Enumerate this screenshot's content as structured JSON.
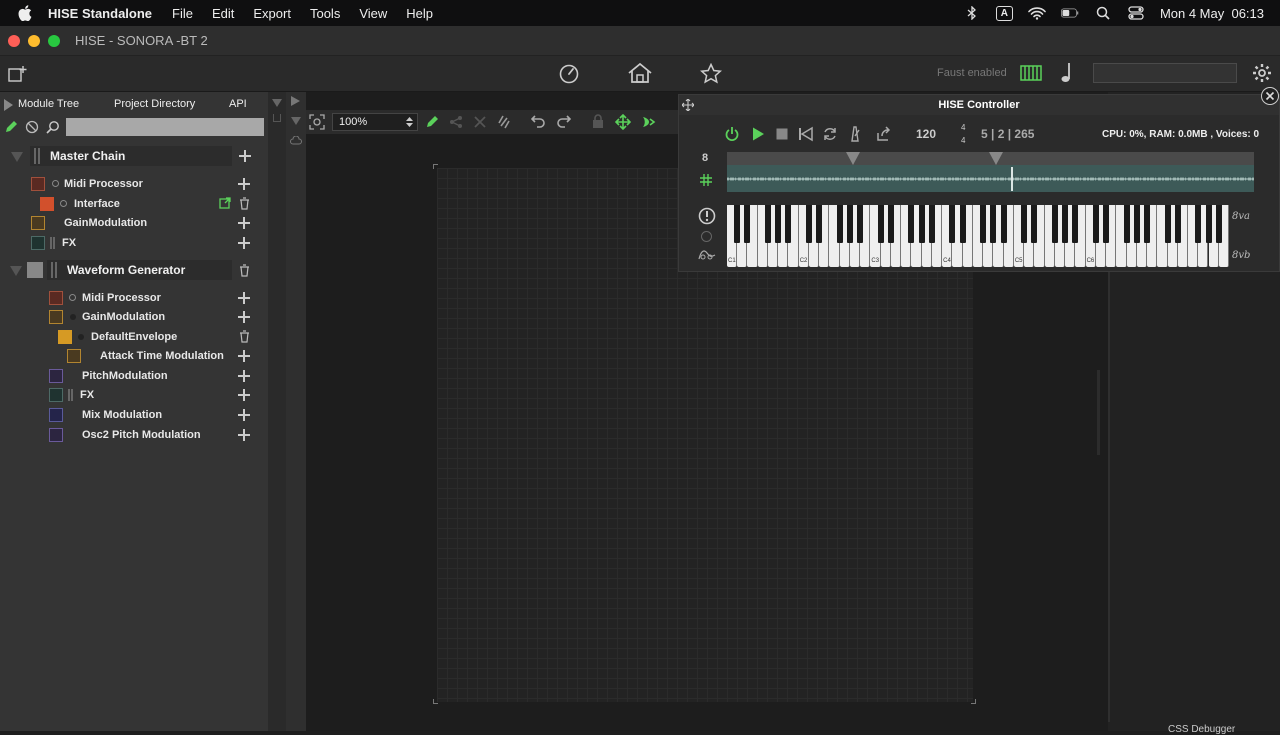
{
  "menubar": {
    "app_name": "HISE Standalone",
    "menus": [
      "File",
      "Edit",
      "Export",
      "Tools",
      "View",
      "Help"
    ],
    "input_source": "A",
    "clock": "Mon 4 May  06:13"
  },
  "window": {
    "title": "HISE - SONORA -BT 2"
  },
  "toolbar": {
    "faust_status": "Faust enabled"
  },
  "left_panel": {
    "tabs": [
      "Module Tree",
      "Project Directory",
      "API"
    ],
    "search_placeholder": "",
    "tree": {
      "master_chain": "Master Chain",
      "master_children": [
        {
          "label": "Midi Processor",
          "color": "#7a3a2e"
        },
        {
          "label": "Interface",
          "color": "#d2502c"
        },
        {
          "label": "GainModulation",
          "color": "#8a6420"
        },
        {
          "label": "FX",
          "color": "#2f4f4a"
        }
      ],
      "waveform_generator": "Waveform Generator",
      "waveform_children": [
        {
          "label": "Midi Processor",
          "color": "#7a3a2e"
        },
        {
          "label": "GainModulation",
          "color": "#8a6420"
        },
        {
          "label": "DefaultEnvelope",
          "color": "#d69a24"
        },
        {
          "label": "Attack Time Modulation",
          "color": "#7a5a22"
        },
        {
          "label": "PitchModulation",
          "color": "#4a3a6a"
        },
        {
          "label": "FX",
          "color": "#2f4f4a"
        },
        {
          "label": "Mix Modulation",
          "color": "#3a3a6a"
        },
        {
          "label": "Osc2 Pitch Modulation",
          "color": "#4a3a6a"
        }
      ]
    }
  },
  "canvas": {
    "zoom": "100%"
  },
  "controller": {
    "title": "HISE Controller",
    "bpm": "120",
    "time_sig_num": "4",
    "time_sig_den": "4",
    "position": "5 | 2 | 265",
    "stats": "CPU: 0%, RAM: 0.0MB , Voices: 0",
    "track_number": "8",
    "octave_up": "8va",
    "octave_down": "8vb",
    "key_labels": [
      "C1",
      "C2",
      "C3",
      "C4",
      "C5",
      "C6"
    ]
  },
  "right_panel": {
    "bottom_label": "CSS Debugger"
  },
  "colors": {
    "accent_green": "#5bd15b",
    "timeline_teal": "#3d5a58"
  }
}
